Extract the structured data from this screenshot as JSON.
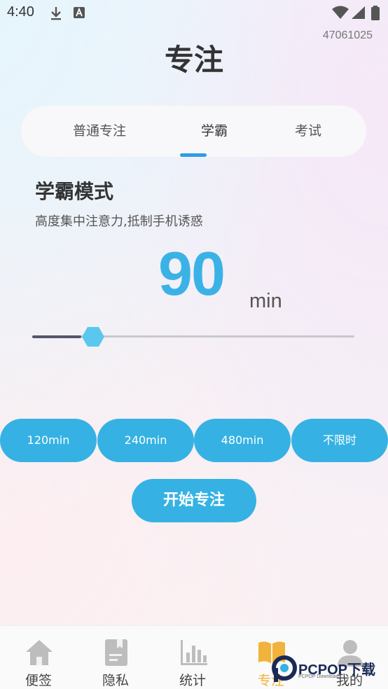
{
  "status_bar": {
    "time": "4:40",
    "icons": [
      "download-icon",
      "a-box-icon",
      "wifi-icon",
      "signal-icon",
      "battery-icon"
    ]
  },
  "user_id": "47061025",
  "header": {
    "title": "专注"
  },
  "tabs": [
    {
      "label": "普通专注",
      "active": false
    },
    {
      "label": "学霸",
      "active": true
    },
    {
      "label": "考试",
      "active": false
    }
  ],
  "mode": {
    "title": "学霸模式",
    "description": "高度集中注意力,抵制手机诱惑"
  },
  "timer": {
    "minutes": "90",
    "unit": "min",
    "slider_level": 0.19
  },
  "presets": [
    {
      "label": "120min"
    },
    {
      "label": "240min"
    },
    {
      "label": "480min"
    },
    {
      "label": "不限时"
    }
  ],
  "start_button": {
    "label": "开始专注"
  },
  "bottom_nav": [
    {
      "label": "便签",
      "icon": "home-icon",
      "active": false
    },
    {
      "label": "隐私",
      "icon": "notebook-icon",
      "active": false
    },
    {
      "label": "统计",
      "icon": "bar-chart-icon",
      "active": false
    },
    {
      "label": "专注",
      "icon": "book-icon",
      "active": true
    },
    {
      "label": "我的",
      "icon": "user-icon",
      "active": false
    }
  ],
  "watermark": {
    "text": "PCPOP下载",
    "subtext": "PCPOP Download"
  },
  "colors": {
    "accent": "#35b2e3",
    "timer": "#3bb2e6",
    "tab_indicator": "#2e9be6",
    "nav_active": "#f1b33b",
    "slider_fill": "#55546a"
  }
}
